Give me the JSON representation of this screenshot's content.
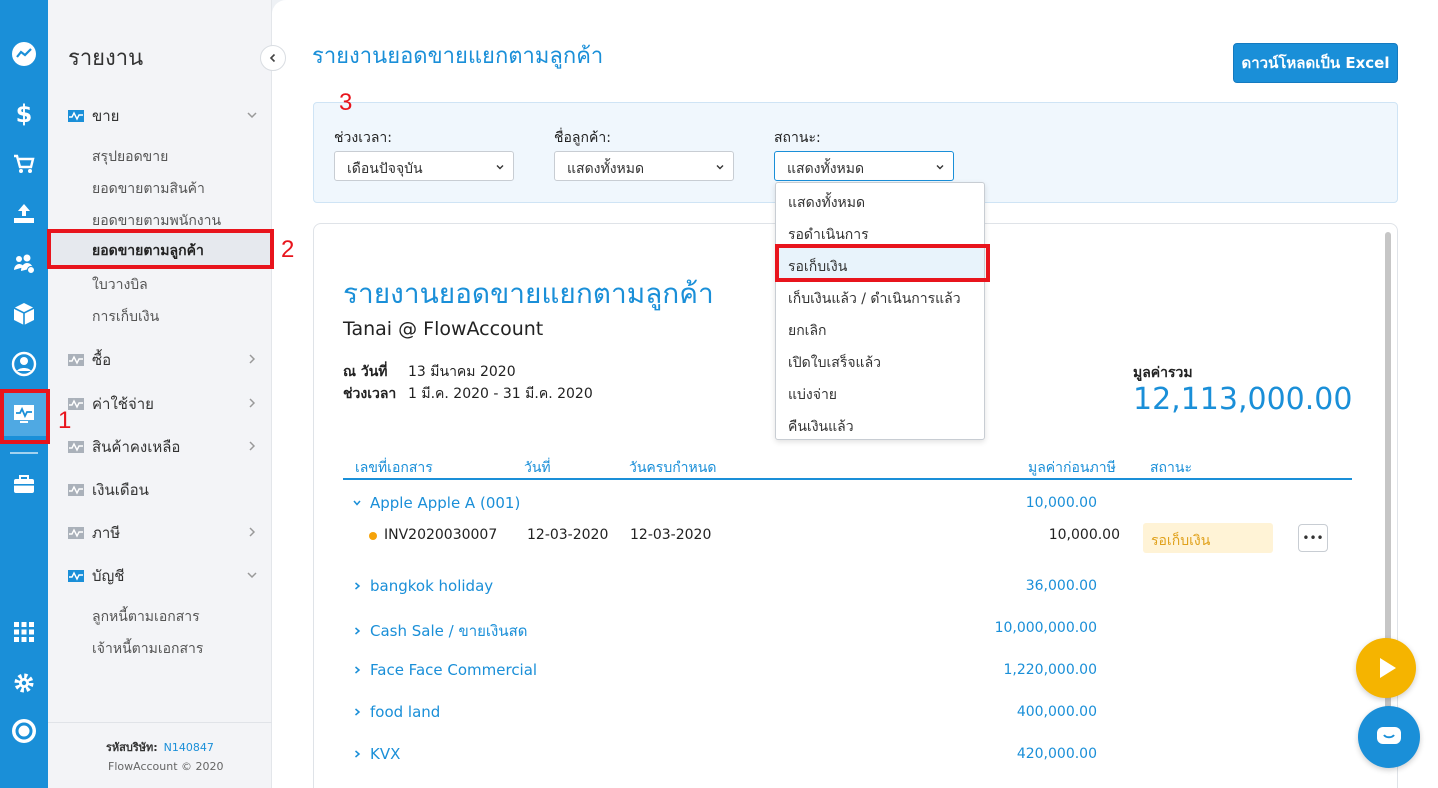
{
  "colors": {
    "brand": "#1a8fd8",
    "annotation": "#e8141c",
    "pending": "#f5a30a"
  },
  "rail": {
    "icons": [
      "dashboard-icon",
      "dollar-icon",
      "cart-icon",
      "upload-icon",
      "contacts-icon",
      "box-icon",
      "user-circle-icon",
      "report-icon",
      "briefcase-icon",
      "apps-grid-icon",
      "gear-icon",
      "flowaccount-logo-icon"
    ]
  },
  "sidebar": {
    "title": "รายงาน",
    "sections": {
      "sales": "ขาย",
      "purchase": "ซื้อ",
      "expense": "ค่าใช้จ่าย",
      "inventory": "สินค้าคงเหลือ",
      "salary": "เงินเดือน",
      "tax": "ภาษี",
      "accounting": "บัญชี"
    },
    "sales_items": [
      "สรุปยอดขาย",
      "ยอดขายตามสินค้า",
      "ยอดขายตามพนักงาน",
      "ยอดขายตามลูกค้า",
      "ใบวางบิล",
      "การเก็บเงิน"
    ],
    "accounting_items": [
      "ลูกหนี้ตามเอกสาร",
      "เจ้าหนี้ตามเอกสาร"
    ],
    "company_label": "รหัสบริษัท:",
    "company_code": "N140847",
    "copyright": "FlowAccount © 2020"
  },
  "annotations": [
    "1",
    "2",
    "3"
  ],
  "header": {
    "title": "รายงานยอดขายแยกตามลูกค้า",
    "excel_button": "ดาวน์โหลดเป็น Excel"
  },
  "filters": {
    "period_label": "ช่วงเวลา:",
    "period_value": "เดือนปัจจุบัน",
    "customer_label": "ชื่อลูกค้า:",
    "customer_value": "แสดงทั้งหมด",
    "status_label": "สถานะ:",
    "status_value": "แสดงทั้งหมด",
    "status_options": [
      "แสดงทั้งหมด",
      "รอดำเนินการ",
      "รอเก็บเงิน",
      "เก็บเงินแล้ว / ดำเนินการแล้ว",
      "ยกเลิก",
      "เปิดใบเสร็จแล้ว",
      "แบ่งจ่าย",
      "คืนเงินแล้ว"
    ]
  },
  "report": {
    "title": "รายงานยอดขายแยกตามลูกค้า",
    "company": "Tanai @ FlowAccount",
    "date_label": "ณ วันที่",
    "date_value": "13 มีนาคม 2020",
    "period_label": "ช่วงเวลา",
    "period_value": "1 มี.ค. 2020 - 31 มี.ค. 2020",
    "total_label": "มูลค่ารวม",
    "total_value": "12,113,000.00",
    "columns": [
      "เลขที่เอกสาร",
      "วันที่",
      "วันครบกำหนด",
      "มูลค่าก่อนภาษี",
      "สถานะ"
    ],
    "groups": [
      {
        "name": "Apple Apple A (001)",
        "amount": "10,000.00"
      },
      {
        "name": "bangkok holiday",
        "amount": "36,000.00"
      },
      {
        "name": "Cash Sale / ขายเงินสด",
        "amount": "10,000,000.00"
      },
      {
        "name": "Face Face Commercial",
        "amount": "1,220,000.00"
      },
      {
        "name": "food land",
        "amount": "400,000.00"
      },
      {
        "name": "KVX",
        "amount": "420,000.00"
      }
    ],
    "doc_row": {
      "doc_no": "INV2020030007",
      "date": "12-03-2020",
      "due": "12-03-2020",
      "amount": "10,000.00",
      "status": "รอเก็บเงิน",
      "more": "•••"
    }
  }
}
